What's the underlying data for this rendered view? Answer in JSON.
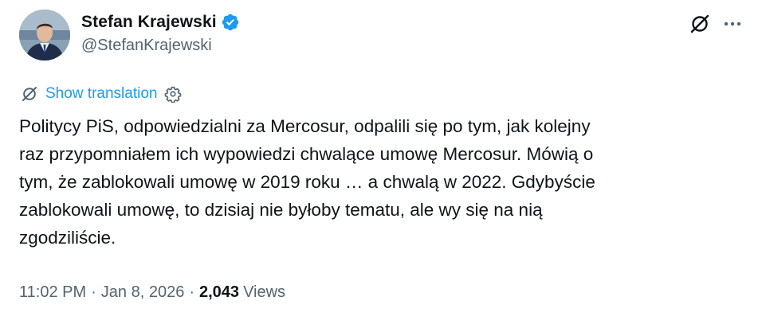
{
  "author": {
    "display_name": "Stefan Krajewski",
    "handle": "@StefanKrajewski",
    "verified": true,
    "verified_color": "#1d9bf0"
  },
  "actions": {
    "grok_icon": "grok-slash-icon",
    "more_icon": "more-horizontal-icon"
  },
  "translation": {
    "link_label": "Show translation",
    "icon": "translate-icon",
    "settings_icon": "gear-icon",
    "link_color": "#1d9bf0"
  },
  "tweet": {
    "lines": [
      "Politycy PiS, odpowiedzialni za Mercosur, odpalili się po tym, jak kolejny",
      "raz przypomniałem ich wypowiedzi chwalące umowę Mercosur. Mówią o",
      "tym, że zablokowali umowę w 2019 roku … a chwalą w 2022. Gdybyście",
      "zablokowali umowę, to dzisiaj nie byłoby tematu, ale wy się na nią",
      "zgodziliście."
    ]
  },
  "meta": {
    "time": "11:02 PM",
    "separator": "·",
    "date": "Jan 8, 2026",
    "views_count": "2,043",
    "views_label": "Views"
  }
}
